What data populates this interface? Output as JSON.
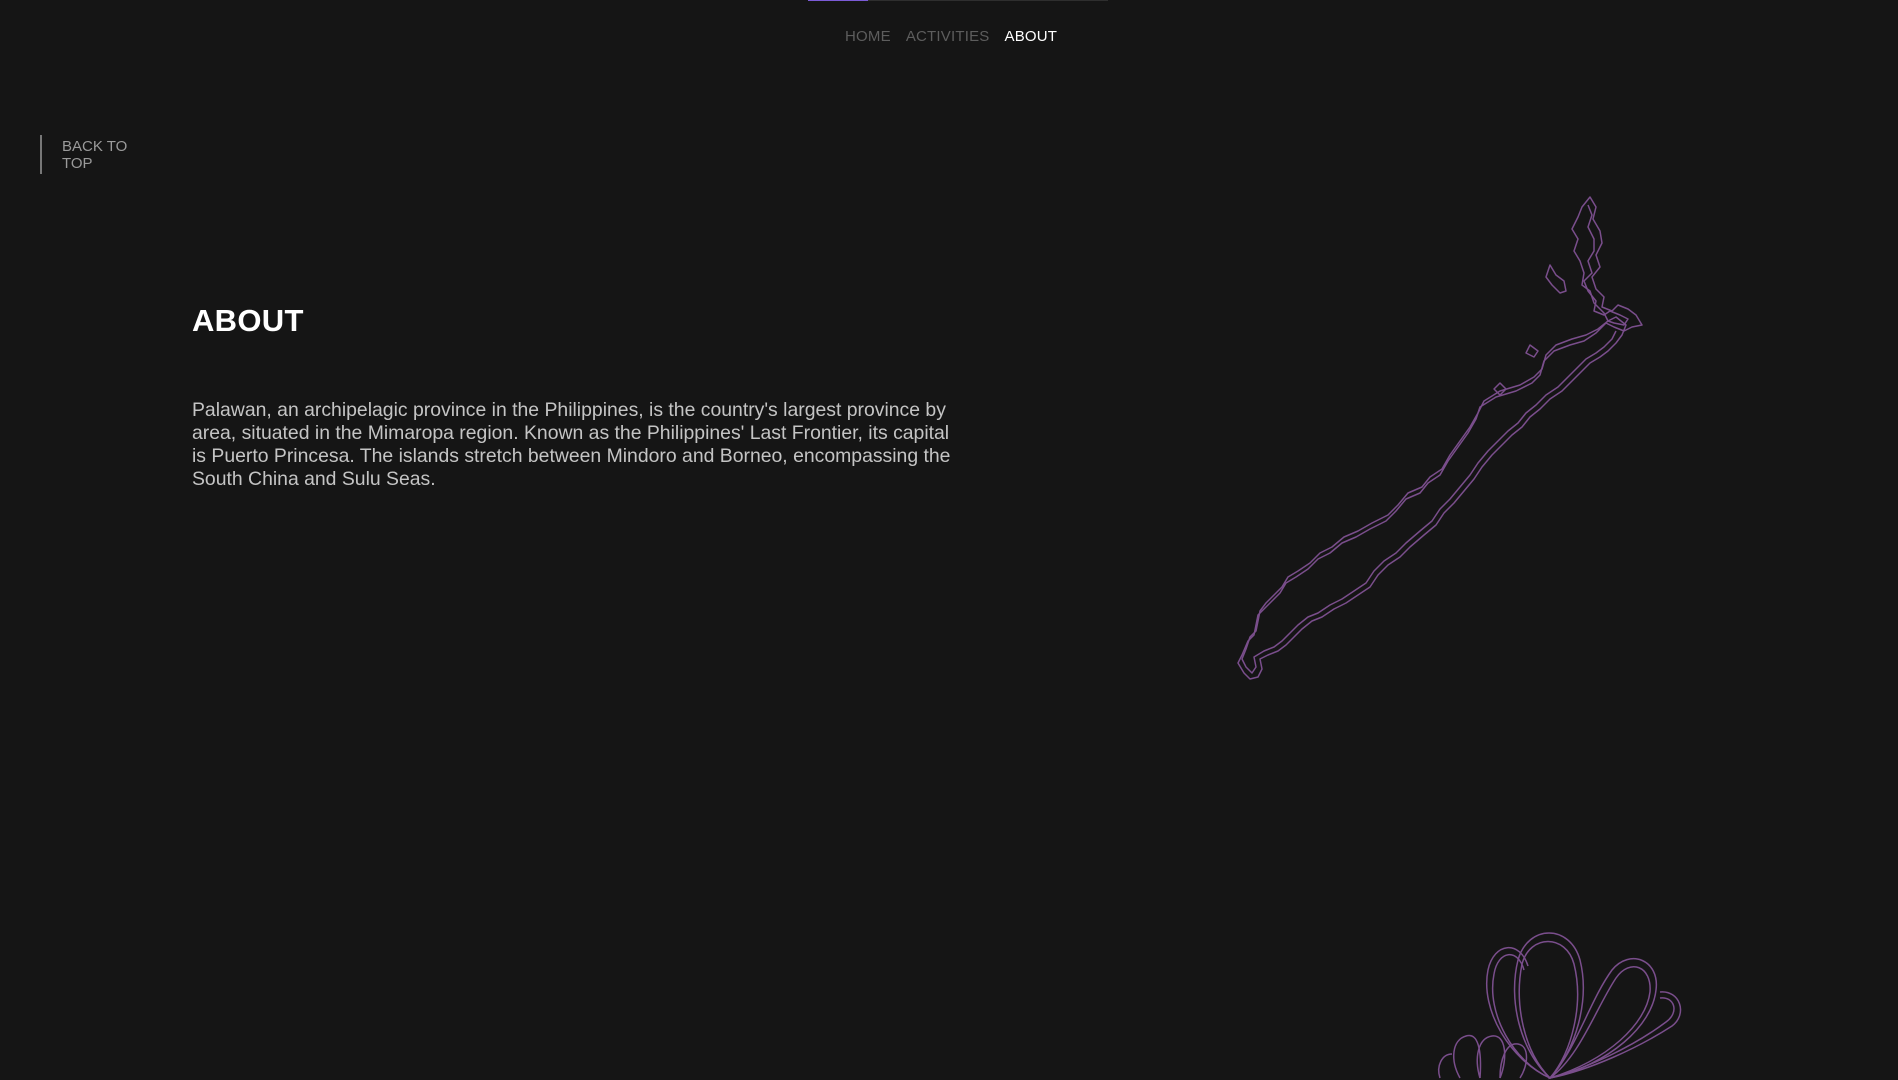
{
  "page": {
    "background_color": "#151515",
    "accent_color": "#7b5bd6",
    "outline_color": "#7a4e8c"
  },
  "progress": {
    "value": 0.2
  },
  "nav": {
    "items": [
      {
        "label": "HOME",
        "active": false
      },
      {
        "label": "ACTIVITIES",
        "active": false
      },
      {
        "label": "ABOUT",
        "active": true
      }
    ]
  },
  "back_to_top": {
    "label": "BACK TO TOP"
  },
  "about": {
    "title": "ABOUT",
    "body": "Palawan, an archipelagic province in the Philippines, is the country's largest province by area, situated in the Mimaropa region. Known as the Philippines' Last Frontier, its capital is Puerto Princesa. The islands stretch between Mindoro and Borneo, encompassing the South China and Sulu Seas."
  },
  "decorations": {
    "map_icon": "palawan-map-outline-icon",
    "shell_icon": "seashell-outline-icon"
  }
}
